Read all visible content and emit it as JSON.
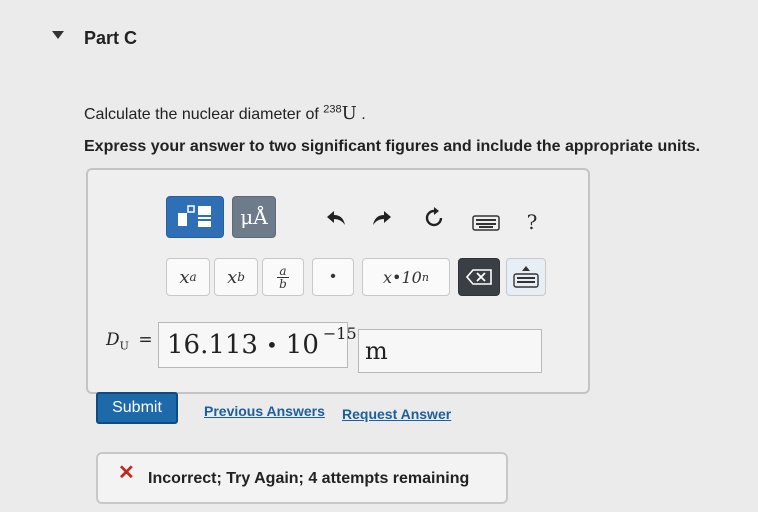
{
  "part": {
    "title": "Part C"
  },
  "question": {
    "text_before": "Calculate the nuclear diameter of ",
    "isotope_mass": "238",
    "element": "U",
    "text_after": "."
  },
  "instruction": "Express your answer to two significant figures and include the appropriate units.",
  "toolbar": {
    "units_label": "μÅ",
    "help_label": "?",
    "superscript_label": "x",
    "superscript_exp": "a",
    "subscript_label": "x",
    "subscript_sub": "b",
    "fraction_num": "a",
    "fraction_den": "b",
    "dot_label": "•",
    "sci_label": "x•10",
    "sci_exp": "n"
  },
  "answer": {
    "variable": "D",
    "variable_sub": "U",
    "equals": "=",
    "mantissa": "16.113",
    "times": "•",
    "base": "10",
    "exponent": "−15",
    "unit": "m"
  },
  "actions": {
    "submit_label": "Submit",
    "previous_answers": "Previous Answers",
    "request_answer": "Request Answer"
  },
  "feedback": {
    "text": "Incorrect; Try Again; 4 attempts remaining",
    "status_color": "#c2271d"
  },
  "colors": {
    "accent": "#1d69a9",
    "link": "#1d5f9e"
  }
}
